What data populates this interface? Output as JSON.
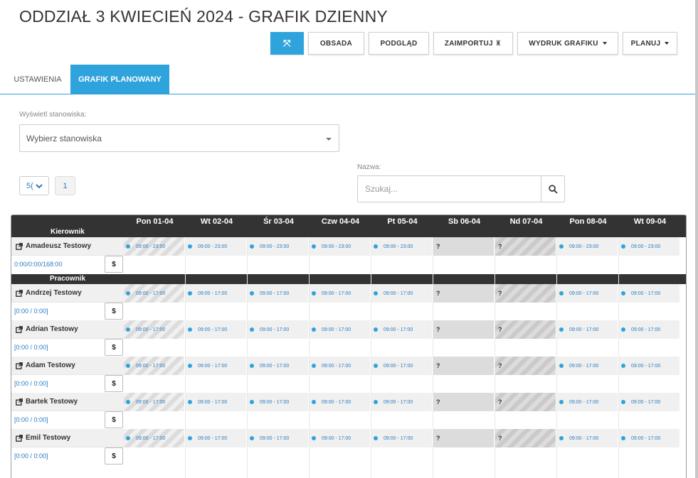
{
  "title": "ODDZIAŁ 3 KWIECIEŃ 2024 - GRAFIK DZIENNY",
  "toolbar": {
    "expand_icon": "⤧",
    "obsada": "OBSADA",
    "podglad": "PODGLĄD",
    "zaimportuj": "ZAIMPORTUJ",
    "zaimportuj_icon": "♜",
    "wydruk": "WYDRUK GRAFIKU",
    "planuj": "PLANUJ"
  },
  "tabs": {
    "ustawienia": "USTAWIENIA",
    "grafik": "GRAFIK PLANOWANY"
  },
  "filters": {
    "stanowiska_label": "Wyświetl stanowiska:",
    "stanowiska_placeholder": "Wybierz stanowiska",
    "per_page": "5(",
    "page": "1",
    "nazwa_label": "Nazwa:",
    "search_placeholder": "Szukaj..."
  },
  "days": [
    "Pon 01-04",
    "Wt 02-04",
    "Śr 03-04",
    "Czw 04-04",
    "Pt 05-04",
    "Sb 06-04",
    "Nd 07-04",
    "Pon 08-04",
    "Wt 09-04"
  ],
  "sections": {
    "kierownik": "Kierownik",
    "pracownik": "Pracownik"
  },
  "dollar": "$",
  "unknown": "?",
  "manager": {
    "name": "Amadeusz Testowy",
    "hours": "0:00/0:00/168:00",
    "shift": "09:00 - 23:00"
  },
  "employees": [
    {
      "name": "Andrzej Testowy",
      "hours": "[0:00 / 0:00]",
      "shift": "09:00 - 17:00"
    },
    {
      "name": "Adrian Testowy",
      "hours": "[0:00 / 0:00]",
      "shift": "09:00 - 17:00"
    },
    {
      "name": "Adam Testowy",
      "hours": "[0:00 / 0:00]",
      "shift": "09:00 - 17:00"
    },
    {
      "name": "Bartek Testowy",
      "hours": "[0:00 / 0:00]",
      "shift": "09:00 - 17:00"
    },
    {
      "name": "Emil Testowy",
      "hours": "[0:00 / 0:00]",
      "shift": "09:00 - 17:00"
    }
  ],
  "colors": {
    "accent": "#2fa3dc",
    "header_dark": "#333333",
    "link": "#2a7cc0"
  }
}
